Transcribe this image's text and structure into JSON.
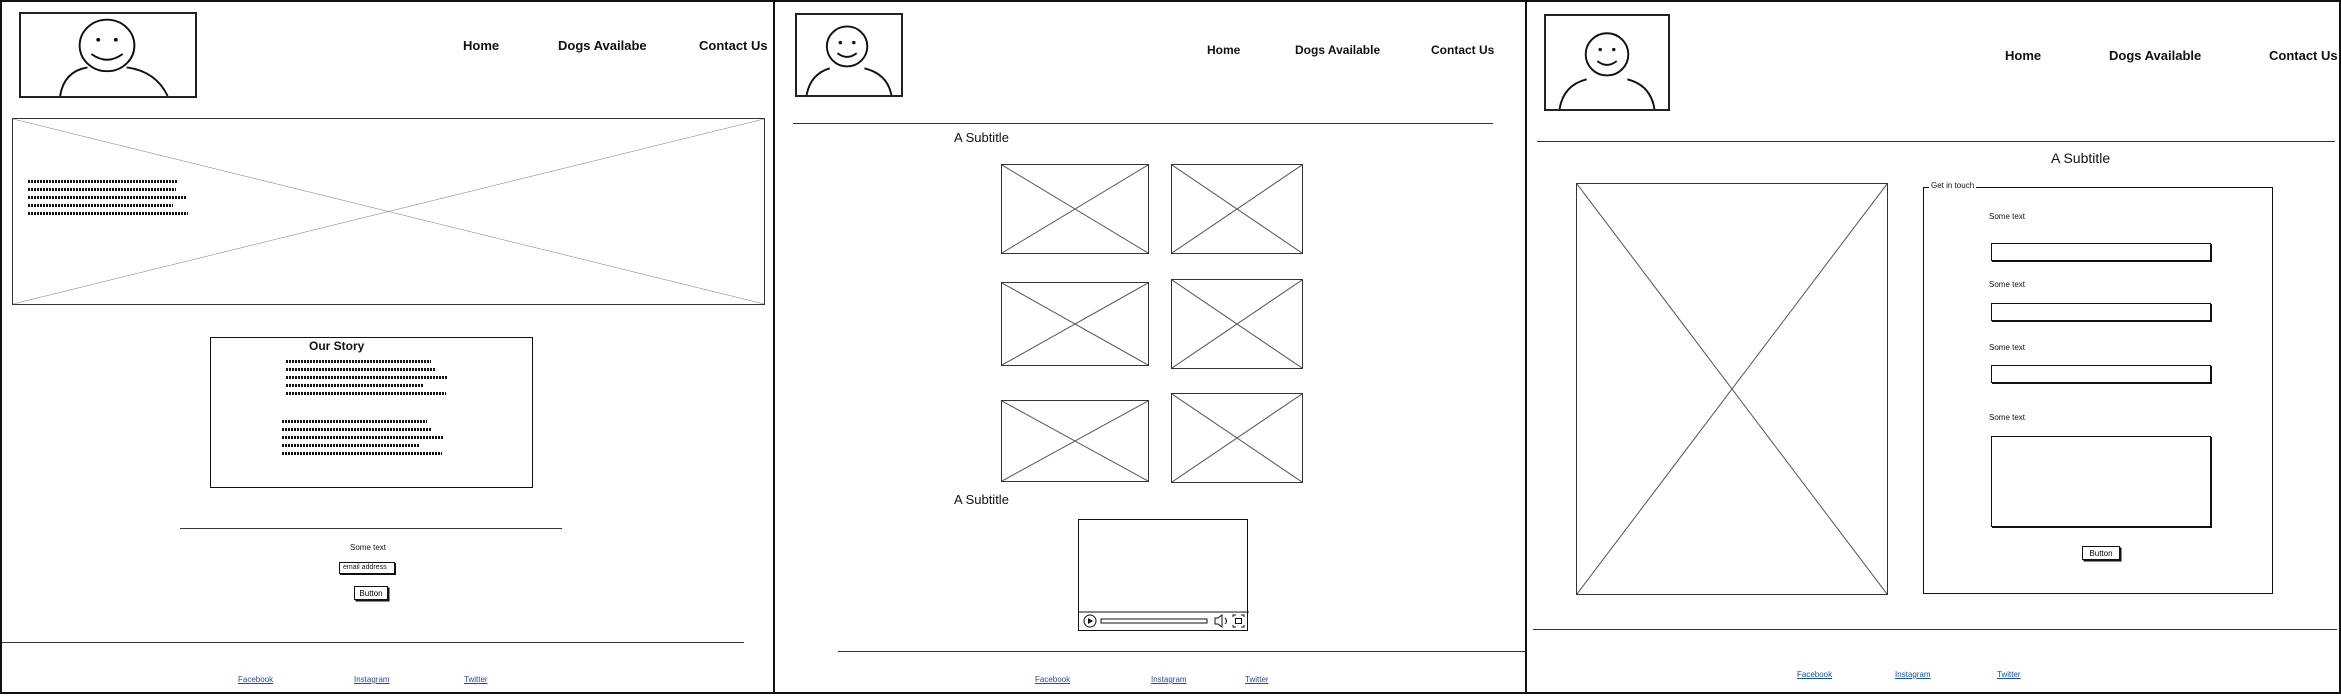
{
  "panel_home": {
    "nav": [
      "Home",
      "Dogs Availabe",
      "Contact Us"
    ],
    "story_title": "Our Story",
    "signup_text": "Some text",
    "email_value": "email address",
    "button_label": "Button",
    "footer_links": [
      "Facebook",
      "Instagram",
      "Twitter"
    ]
  },
  "panel_dogs": {
    "nav": [
      "Home",
      "Dogs Available",
      "Contact Us"
    ],
    "subtitle_1": "A Subtitle",
    "subtitle_2": "A Subtitle",
    "footer_links": [
      "Facebook",
      "Instagram",
      "Twitter"
    ]
  },
  "panel_contact": {
    "nav": [
      "Home",
      "Dogs Available",
      "Contact Us"
    ],
    "subtitle": "A Subtitle",
    "fieldset_legend": "Get in touch",
    "field_labels": [
      "Some text",
      "Some text",
      "Some text",
      "Some text"
    ],
    "button_label": "Button",
    "footer_links": [
      "Facebook",
      "Instagram",
      "Twitter"
    ]
  },
  "icons": [
    "smiley-logo-icon",
    "image-placeholder-icon",
    "video-play-icon",
    "volume-icon",
    "fullscreen-icon"
  ]
}
